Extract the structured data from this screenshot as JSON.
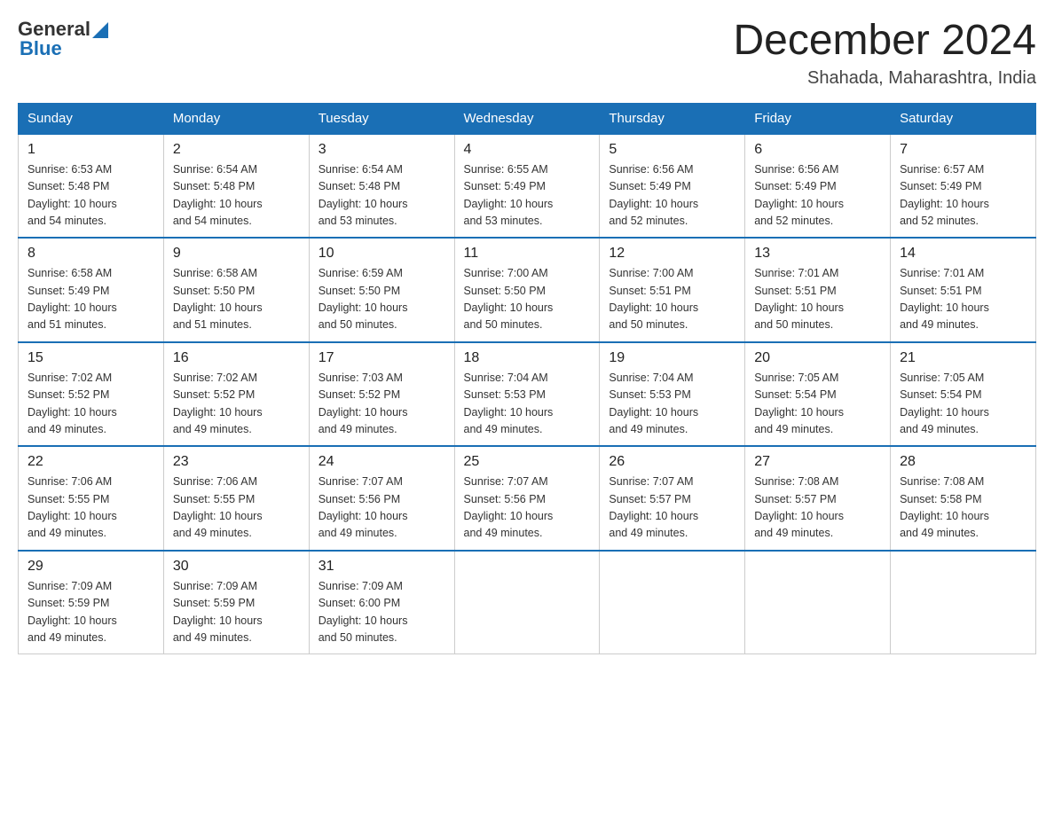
{
  "header": {
    "logo_general": "General",
    "logo_blue": "Blue",
    "month_title": "December 2024",
    "location": "Shahada, Maharashtra, India"
  },
  "days_of_week": [
    "Sunday",
    "Monday",
    "Tuesday",
    "Wednesday",
    "Thursday",
    "Friday",
    "Saturday"
  ],
  "weeks": [
    [
      {
        "num": "1",
        "sunrise": "6:53 AM",
        "sunset": "5:48 PM",
        "daylight": "10 hours and 54 minutes."
      },
      {
        "num": "2",
        "sunrise": "6:54 AM",
        "sunset": "5:48 PM",
        "daylight": "10 hours and 54 minutes."
      },
      {
        "num": "3",
        "sunrise": "6:54 AM",
        "sunset": "5:48 PM",
        "daylight": "10 hours and 53 minutes."
      },
      {
        "num": "4",
        "sunrise": "6:55 AM",
        "sunset": "5:49 PM",
        "daylight": "10 hours and 53 minutes."
      },
      {
        "num": "5",
        "sunrise": "6:56 AM",
        "sunset": "5:49 PM",
        "daylight": "10 hours and 52 minutes."
      },
      {
        "num": "6",
        "sunrise": "6:56 AM",
        "sunset": "5:49 PM",
        "daylight": "10 hours and 52 minutes."
      },
      {
        "num": "7",
        "sunrise": "6:57 AM",
        "sunset": "5:49 PM",
        "daylight": "10 hours and 52 minutes."
      }
    ],
    [
      {
        "num": "8",
        "sunrise": "6:58 AM",
        "sunset": "5:49 PM",
        "daylight": "10 hours and 51 minutes."
      },
      {
        "num": "9",
        "sunrise": "6:58 AM",
        "sunset": "5:50 PM",
        "daylight": "10 hours and 51 minutes."
      },
      {
        "num": "10",
        "sunrise": "6:59 AM",
        "sunset": "5:50 PM",
        "daylight": "10 hours and 50 minutes."
      },
      {
        "num": "11",
        "sunrise": "7:00 AM",
        "sunset": "5:50 PM",
        "daylight": "10 hours and 50 minutes."
      },
      {
        "num": "12",
        "sunrise": "7:00 AM",
        "sunset": "5:51 PM",
        "daylight": "10 hours and 50 minutes."
      },
      {
        "num": "13",
        "sunrise": "7:01 AM",
        "sunset": "5:51 PM",
        "daylight": "10 hours and 50 minutes."
      },
      {
        "num": "14",
        "sunrise": "7:01 AM",
        "sunset": "5:51 PM",
        "daylight": "10 hours and 49 minutes."
      }
    ],
    [
      {
        "num": "15",
        "sunrise": "7:02 AM",
        "sunset": "5:52 PM",
        "daylight": "10 hours and 49 minutes."
      },
      {
        "num": "16",
        "sunrise": "7:02 AM",
        "sunset": "5:52 PM",
        "daylight": "10 hours and 49 minutes."
      },
      {
        "num": "17",
        "sunrise": "7:03 AM",
        "sunset": "5:52 PM",
        "daylight": "10 hours and 49 minutes."
      },
      {
        "num": "18",
        "sunrise": "7:04 AM",
        "sunset": "5:53 PM",
        "daylight": "10 hours and 49 minutes."
      },
      {
        "num": "19",
        "sunrise": "7:04 AM",
        "sunset": "5:53 PM",
        "daylight": "10 hours and 49 minutes."
      },
      {
        "num": "20",
        "sunrise": "7:05 AM",
        "sunset": "5:54 PM",
        "daylight": "10 hours and 49 minutes."
      },
      {
        "num": "21",
        "sunrise": "7:05 AM",
        "sunset": "5:54 PM",
        "daylight": "10 hours and 49 minutes."
      }
    ],
    [
      {
        "num": "22",
        "sunrise": "7:06 AM",
        "sunset": "5:55 PM",
        "daylight": "10 hours and 49 minutes."
      },
      {
        "num": "23",
        "sunrise": "7:06 AM",
        "sunset": "5:55 PM",
        "daylight": "10 hours and 49 minutes."
      },
      {
        "num": "24",
        "sunrise": "7:07 AM",
        "sunset": "5:56 PM",
        "daylight": "10 hours and 49 minutes."
      },
      {
        "num": "25",
        "sunrise": "7:07 AM",
        "sunset": "5:56 PM",
        "daylight": "10 hours and 49 minutes."
      },
      {
        "num": "26",
        "sunrise": "7:07 AM",
        "sunset": "5:57 PM",
        "daylight": "10 hours and 49 minutes."
      },
      {
        "num": "27",
        "sunrise": "7:08 AM",
        "sunset": "5:57 PM",
        "daylight": "10 hours and 49 minutes."
      },
      {
        "num": "28",
        "sunrise": "7:08 AM",
        "sunset": "5:58 PM",
        "daylight": "10 hours and 49 minutes."
      }
    ],
    [
      {
        "num": "29",
        "sunrise": "7:09 AM",
        "sunset": "5:59 PM",
        "daylight": "10 hours and 49 minutes."
      },
      {
        "num": "30",
        "sunrise": "7:09 AM",
        "sunset": "5:59 PM",
        "daylight": "10 hours and 49 minutes."
      },
      {
        "num": "31",
        "sunrise": "7:09 AM",
        "sunset": "6:00 PM",
        "daylight": "10 hours and 50 minutes."
      },
      null,
      null,
      null,
      null
    ]
  ],
  "labels": {
    "sunrise": "Sunrise:",
    "sunset": "Sunset:",
    "daylight": "Daylight:"
  }
}
